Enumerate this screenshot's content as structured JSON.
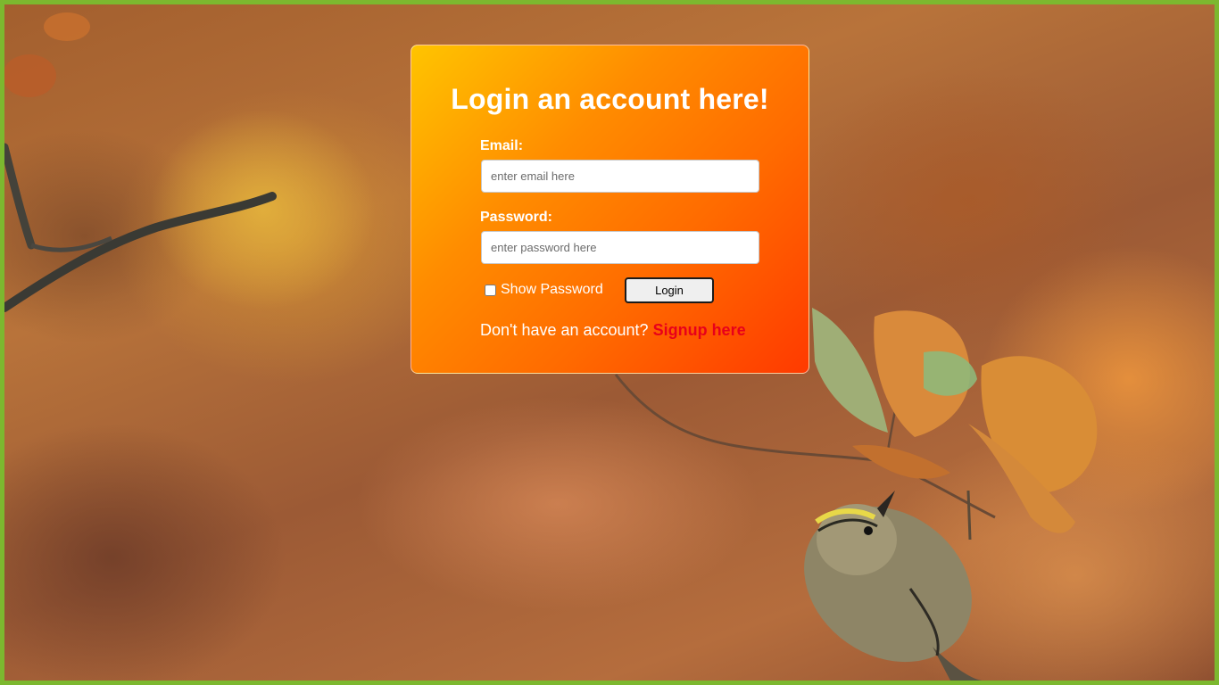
{
  "login": {
    "title": "Login an account here!",
    "email_label": "Email:",
    "email_value": "",
    "email_placeholder": "enter email here",
    "password_label": "Password:",
    "password_value": "",
    "password_placeholder": "enter password here",
    "show_password_label": "Show Password",
    "show_password_checked": false,
    "login_button": "Login",
    "signup_prompt": "Don't have an account?",
    "signup_link": "Signup here"
  },
  "colors": {
    "page_border": "#7cb82f",
    "card_gradient_start": "#ffc400",
    "card_gradient_end": "#ff3a00",
    "signup_link": "#e8001a"
  },
  "background": {
    "icon": "autumn-leaves-bird-photo"
  }
}
